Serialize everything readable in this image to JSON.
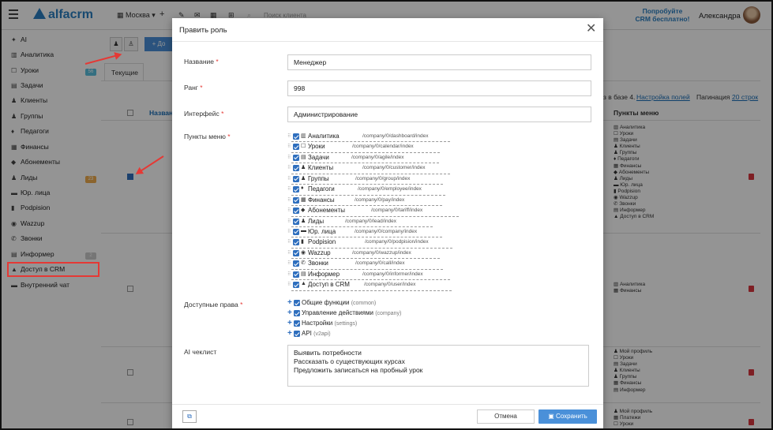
{
  "topbar": {
    "logo": "alfacrm",
    "branch": "Москва",
    "search_placeholder": "Поиск клиента",
    "promo": "Попробуйте CRM бесплатно!",
    "user_name": "Александра"
  },
  "sidebar": {
    "items": [
      {
        "icon": "✦",
        "label": "AI"
      },
      {
        "icon": "▥",
        "label": "Аналитика"
      },
      {
        "icon": "☐",
        "label": "Уроки",
        "badge": "56"
      },
      {
        "icon": "▤",
        "label": "Задачи"
      },
      {
        "icon": "♟",
        "label": "Клиенты"
      },
      {
        "icon": "♟",
        "label": "Группы"
      },
      {
        "icon": "♦",
        "label": "Педагоги"
      },
      {
        "icon": "▦",
        "label": "Финансы"
      },
      {
        "icon": "◆",
        "label": "Абонементы"
      },
      {
        "icon": "♟",
        "label": "Лиды",
        "badge": "23"
      },
      {
        "icon": "▬",
        "label": "Юр. лица"
      },
      {
        "icon": "▮",
        "label": "Podpision"
      },
      {
        "icon": "◉",
        "label": "Wazzup"
      },
      {
        "icon": "✆",
        "label": "Звонки"
      },
      {
        "icon": "▤",
        "label": "Информер",
        "badge": "2"
      },
      {
        "icon": "▲",
        "label": "Доступ в CRM"
      },
      {
        "icon": "▬",
        "label": "Внутренний чат"
      }
    ]
  },
  "background": {
    "tab_current": "Текущие",
    "col_name": "Назван",
    "col_menu": "Пункты меню",
    "info_text": "з в базе 4.",
    "link_fields": "Настройка полей",
    "pagination_label": "Пагинация",
    "pagination_value": "20 строк",
    "add_btn": "+ До",
    "rows": [
      {
        "menu": [
          "▥ Аналитика",
          "☐ Уроки",
          "▤ Задачи",
          "♟ Клиенты",
          "♟ Группы",
          "♦ Педагоги",
          "▦ Финансы",
          "◆ Абонементы",
          "♟ Лиды",
          "▬ Юр. лица",
          "▮ Podpision",
          "◉ Wazzup",
          "✆ Звонки",
          "▤ Информер",
          "▲ Доступ в CRM"
        ]
      },
      {
        "menu": [
          "▥ Аналитика",
          "▦ Финансы"
        ]
      },
      {
        "menu": [
          "♟ Мой профиль",
          "☐ Уроки",
          "▤ Задачи",
          "♟ Клиенты",
          "♟ Группы",
          "▦ Финансы",
          "▤ Информер"
        ]
      },
      {
        "menu": [
          "♟ Мой профиль",
          "▦ Платежи",
          "☐ Уроки"
        ]
      }
    ]
  },
  "modal": {
    "title": "Править роль",
    "close": "✕",
    "fields": {
      "name_label": "Название",
      "name_value": "Менеджер",
      "rank_label": "Ранг",
      "rank_value": "998",
      "interface_label": "Интерфейс",
      "interface_value": "Администрирование",
      "menu_label": "Пункты меню",
      "rights_label": "Доступные права",
      "ai_label": "AI чеклист"
    },
    "menu_items": [
      {
        "icon": "▥",
        "label": "Аналитика",
        "path": "/company/0/dashboard/index"
      },
      {
        "icon": "☐",
        "label": "Уроки",
        "path": "/company/0/calendar/index"
      },
      {
        "icon": "▤",
        "label": "Задачи",
        "path": "/company/0/agile/index"
      },
      {
        "icon": "♟",
        "label": "Клиенты",
        "path": "/company/0/customer/index"
      },
      {
        "icon": "♟",
        "label": "Группы",
        "path": "/company/0/group/index"
      },
      {
        "icon": "♦",
        "label": "Педагоги",
        "path": "/company/0/employee/index"
      },
      {
        "icon": "▦",
        "label": "Финансы",
        "path": "/company/0/pay/index"
      },
      {
        "icon": "◆",
        "label": "Абонементы",
        "path": "/company/0/tariff/index"
      },
      {
        "icon": "♟",
        "label": "Лиды",
        "path": "/company/0/lead/index"
      },
      {
        "icon": "▬",
        "label": "Юр. лица",
        "path": "/company/0/company/index"
      },
      {
        "icon": "▮",
        "label": "Podpision",
        "path": "/company/0/podpision/index"
      },
      {
        "icon": "◉",
        "label": "Wazzup",
        "path": "/company/0/wazzup/index"
      },
      {
        "icon": "✆",
        "label": "Звонки",
        "path": "/company/0/call/index"
      },
      {
        "icon": "▤",
        "label": "Информер",
        "path": "/company/0/informer/index"
      },
      {
        "icon": "▲",
        "label": "Доступ в CRM",
        "path": "/company/0/user/index"
      }
    ],
    "rights": [
      {
        "label": "Общие функции",
        "sub": "(common)"
      },
      {
        "label": "Управление действиями",
        "sub": "(company)"
      },
      {
        "label": "Настройки",
        "sub": "(settings)"
      },
      {
        "label": "API",
        "sub": "(v2api)"
      }
    ],
    "ai_checklist": [
      "Выявить потребности",
      "Рассказать о существующих курсах",
      "Предложить записаться на пробный урок"
    ],
    "cancel": "Отмена",
    "save": "Сохранить"
  }
}
